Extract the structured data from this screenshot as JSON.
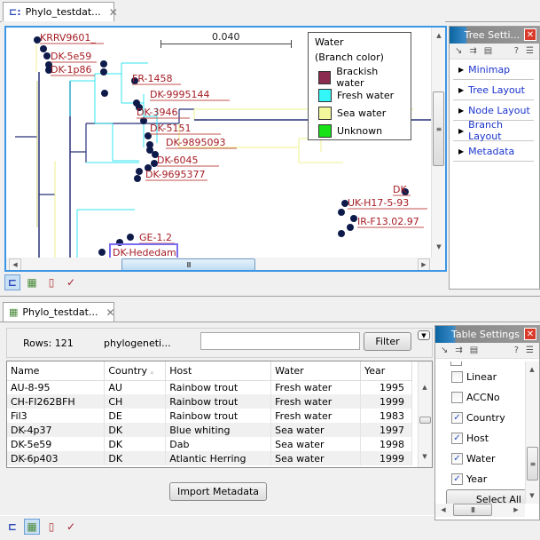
{
  "tree_editor": {
    "tab_label": "Phylo_testdat...",
    "tab_close": "✕",
    "scale_bar_label": "0.040",
    "legend": {
      "title": "Water",
      "subtitle": "(Branch color)",
      "entries": [
        {
          "label": "Brackish water",
          "color": "#8b2b4f"
        },
        {
          "label": "Fresh water",
          "color": "#33f6f6"
        },
        {
          "label": "Sea water",
          "color": "#f2f79b"
        },
        {
          "label": "Unknown",
          "color": "#17e217"
        }
      ]
    },
    "leaf_labels": [
      "KRRV9601_",
      "DK-5e59",
      "DK-1p86",
      "FR-1458",
      "DK-9995144",
      "DK-3946",
      "DK-5151",
      "DK-9895093",
      "DK-6045",
      "DK-9695377",
      "DK",
      "UK-H17-5-93",
      "IR-F13.02.97",
      "GE-1.2",
      "DK-Hededam"
    ],
    "colors": {
      "branch_dark": "#283278",
      "branch_fresh": "#33e6f0",
      "branch_sea": "#eef08c",
      "node": "#0d1a4a",
      "label": "#a51c24",
      "selection_border": "#3c96e6"
    }
  },
  "tree_settings": {
    "title": "Tree Setti...",
    "help": "?",
    "sections": [
      "Minimap",
      "Tree Layout",
      "Node Layout",
      "Branch Layout",
      "Metadata"
    ]
  },
  "table_editor": {
    "tab_label": "Phylo_testdat...",
    "tab_close": "✕",
    "rows_label": "Rows: 121",
    "source_label": "phylogeneti...",
    "filter_value": "",
    "filter_button": "Filter",
    "columns": [
      "Name",
      "Country",
      "Host",
      "Water",
      "Year"
    ],
    "sort_indicator": "▵",
    "rows": [
      [
        "AU-8-95",
        "AU",
        "Rainbow trout",
        "Fresh water",
        "1995"
      ],
      [
        "CH-FI262BFH",
        "CH",
        "Rainbow trout",
        "Fresh water",
        "1999"
      ],
      [
        "Fil3",
        "DE",
        "Rainbow trout",
        "Fresh water",
        "1983"
      ],
      [
        "DK-4p37",
        "DK",
        "Blue whiting",
        "Sea water",
        "1997"
      ],
      [
        "DK-5e59",
        "DK",
        "Dab",
        "Sea water",
        "1998"
      ],
      [
        "DK-6p403",
        "DK",
        "Atlantic Herring",
        "Sea water",
        "1999"
      ]
    ],
    "import_button": "Import Metadata"
  },
  "table_settings": {
    "title": "Table Settings",
    "help": "?",
    "columns": [
      {
        "label": "Linear",
        "checked": false
      },
      {
        "label": "ACCNo",
        "checked": false
      },
      {
        "label": "Country",
        "checked": true
      },
      {
        "label": "Host",
        "checked": true
      },
      {
        "label": "Water",
        "checked": true
      },
      {
        "label": "Year",
        "checked": true
      }
    ],
    "select_all": "Select All"
  },
  "views": [
    "tree-view",
    "table-view",
    "history-view",
    "annotations-view"
  ]
}
